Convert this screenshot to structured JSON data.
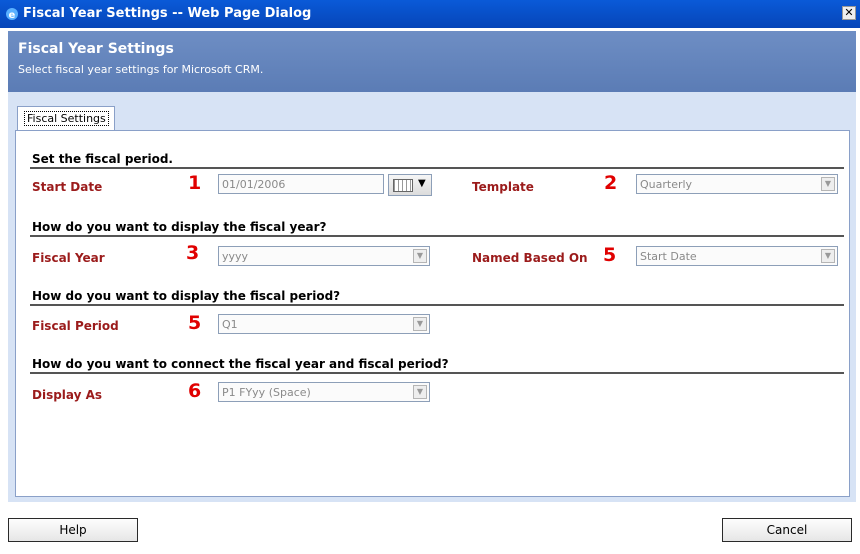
{
  "window": {
    "title": "Fiscal Year Settings -- Web Page Dialog",
    "close_glyph": "✕"
  },
  "header": {
    "title": "Fiscal Year Settings",
    "subtitle": "Select fiscal year settings for Microsoft CRM."
  },
  "tabs": [
    {
      "label": "Fiscal Settings",
      "selected": true
    }
  ],
  "sections": {
    "period": "Set the fiscal period.",
    "year_display": "How do you want to display the fiscal year?",
    "period_display": "How do you want to display the fiscal period?",
    "connect": "How do you want to connect the fiscal year and fiscal period?"
  },
  "fields": {
    "start_date": {
      "label": "Start Date",
      "number": "1",
      "value": "01/01/2006"
    },
    "template": {
      "label": "Template",
      "number": "2",
      "value": "Quarterly"
    },
    "fiscal_year": {
      "label": "Fiscal Year",
      "number": "3",
      "value": "yyyy"
    },
    "named_based_on": {
      "label": "Named Based On",
      "number": "5",
      "value": "Start Date"
    },
    "fiscal_period": {
      "label": "Fiscal Period",
      "number": "5",
      "value": "Q1"
    },
    "display_as": {
      "label": "Display As",
      "number": "6",
      "value": "P1 FYyy (Space)"
    }
  },
  "buttons": {
    "help": "Help",
    "cancel": "Cancel"
  },
  "colors": {
    "label": "#9b1b1b",
    "number": "#e00000",
    "title_bar": "#0a5ad8",
    "header": "#6e8ec4"
  }
}
